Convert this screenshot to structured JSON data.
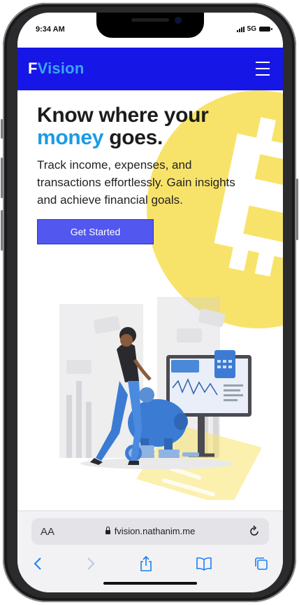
{
  "status": {
    "time": "9:34 AM",
    "network": "5G"
  },
  "nav": {
    "brand_first": "F",
    "brand_rest": "Vision"
  },
  "hero": {
    "title_line1": "Know where your",
    "title_accent": "money",
    "title_rest": " goes.",
    "subtitle": "Track income, expenses, and transactions effortlessly. Gain insights and achieve financial goals.",
    "cta_label": "Get Started"
  },
  "browser": {
    "aa_label": "AA",
    "url": "fvision.nathanim.me"
  },
  "colors": {
    "nav_bg": "#1616e6",
    "accent": "#1a9be6",
    "cta_bg": "#5257f0",
    "coin": "#f8e36a"
  },
  "icons": [
    "menu-icon",
    "lock-icon",
    "reload-icon",
    "back-icon",
    "forward-icon",
    "share-icon",
    "bookmarks-icon",
    "tabs-icon"
  ]
}
